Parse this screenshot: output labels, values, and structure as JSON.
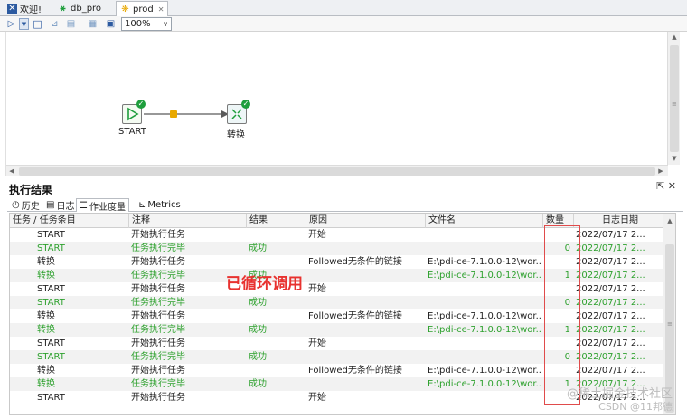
{
  "tabs": [
    {
      "label": "欢迎!",
      "icon": "pdi-icon"
    },
    {
      "label": "db_pro",
      "icon": "transformation-icon"
    },
    {
      "label": "prod",
      "icon": "job-icon"
    }
  ],
  "toolbar": {
    "zoom": "100%"
  },
  "canvas": {
    "steps": [
      {
        "label": "START",
        "icon": "start-icon",
        "status": "success"
      },
      {
        "label": "转换",
        "icon": "transformation-icon",
        "status": "success"
      }
    ]
  },
  "results": {
    "title": "执行结果",
    "tabs": [
      {
        "label": "历史",
        "icon": "history-icon"
      },
      {
        "label": "日志",
        "icon": "log-icon"
      },
      {
        "label": "作业度量",
        "icon": "metrics-table-icon"
      },
      {
        "label": "Metrics",
        "icon": "chart-icon"
      }
    ],
    "columns": [
      "任务 / 任务条目",
      "注释",
      "结果",
      "原因",
      "文件名",
      "数量",
      "日志日期"
    ],
    "rows": [
      [
        "START",
        "开始执行任务",
        "",
        "开始",
        "",
        "",
        "2022/07/17 2..."
      ],
      [
        "START",
        "任务执行完毕",
        "成功",
        "",
        "",
        "0",
        "2022/07/17 2..."
      ],
      [
        "转换",
        "开始执行任务",
        "",
        "Followed无条件的链接",
        "E:\\pdi-ce-7.1.0.0-12\\wor...",
        "",
        "2022/07/17 2..."
      ],
      [
        "转换",
        "任务执行完毕",
        "成功",
        "",
        "E:\\pdi-ce-7.1.0.0-12\\wor...",
        "1",
        "2022/07/17 2..."
      ],
      [
        "START",
        "开始执行任务",
        "",
        "开始",
        "",
        "",
        "2022/07/17 2..."
      ],
      [
        "START",
        "任务执行完毕",
        "成功",
        "",
        "",
        "0",
        "2022/07/17 2..."
      ],
      [
        "转换",
        "开始执行任务",
        "",
        "Followed无条件的链接",
        "E:\\pdi-ce-7.1.0.0-12\\wor...",
        "",
        "2022/07/17 2..."
      ],
      [
        "转换",
        "任务执行完毕",
        "成功",
        "",
        "E:\\pdi-ce-7.1.0.0-12\\wor...",
        "1",
        "2022/07/17 2..."
      ],
      [
        "START",
        "开始执行任务",
        "",
        "开始",
        "",
        "",
        "2022/07/17 2..."
      ],
      [
        "START",
        "任务执行完毕",
        "成功",
        "",
        "",
        "0",
        "2022/07/17 2..."
      ],
      [
        "转换",
        "开始执行任务",
        "",
        "Followed无条件的链接",
        "E:\\pdi-ce-7.1.0.0-12\\wor...",
        "",
        "2022/07/17 2..."
      ],
      [
        "转换",
        "任务执行完毕",
        "成功",
        "",
        "E:\\pdi-ce-7.1.0.0-12\\wor...",
        "1",
        "2022/07/17 2..."
      ],
      [
        "START",
        "开始执行任务",
        "",
        "开始",
        "",
        "",
        "2022/07/17 2..."
      ]
    ],
    "success_color": "#2ea12e"
  },
  "annotation": {
    "text": "已循环调用",
    "color": "#e8322f"
  },
  "watermark": {
    "line1": "@稀土掘金技术社区",
    "line2": "CSDN @11邦德"
  }
}
